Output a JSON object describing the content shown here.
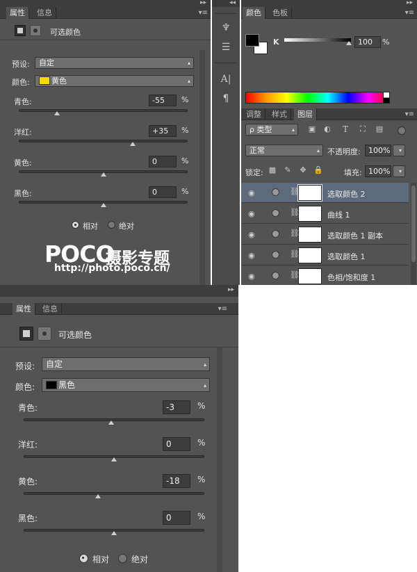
{
  "panel_top": {
    "tabs": [
      "属性",
      "信息"
    ],
    "panel_title": "可选颜色",
    "preset_label": "预设:",
    "preset_value": "自定",
    "color_label": "颜色:",
    "color_value": "黄色",
    "color_swatch": "#f7d900",
    "sliders": [
      {
        "label": "青色:",
        "value": "-55",
        "pos": -55
      },
      {
        "label": "洋红:",
        "value": "+35",
        "pos": 35
      },
      {
        "label": "黄色:",
        "value": "0",
        "pos": 0
      },
      {
        "label": "黑色:",
        "value": "0",
        "pos": 0
      }
    ],
    "pct": "%",
    "radio_relative": "相对",
    "radio_absolute": "绝对"
  },
  "color_panel": {
    "tabs": [
      "颜色",
      "色板"
    ],
    "channel": "K",
    "value": "100",
    "pct": "%"
  },
  "layers_panel": {
    "tabs": [
      "调整",
      "样式",
      "图层"
    ],
    "filter_label": "ρ 类型",
    "blend_mode": "正常",
    "opacity_label": "不透明度:",
    "opacity_value": "100%",
    "lock_label": "锁定:",
    "fill_label": "填充:",
    "fill_value": "100%",
    "layers": [
      {
        "name": "选取颜色 2",
        "selected": true
      },
      {
        "name": "曲线 1",
        "selected": false
      },
      {
        "name": "选取颜色 1 副本",
        "selected": false
      },
      {
        "name": "选取颜色 1",
        "selected": false
      },
      {
        "name": "色相/饱和度 1",
        "selected": false
      }
    ]
  },
  "watermark": {
    "logo": "POCO",
    "text": "摄影专题",
    "url": "http://photo.poco.cn/"
  },
  "panel_bottom": {
    "tabs": [
      "属性",
      "信息"
    ],
    "panel_title": "可选颜色",
    "preset_label": "预设:",
    "preset_value": "自定",
    "color_label": "颜色:",
    "color_value": "黑色",
    "color_swatch": "#000000",
    "sliders": [
      {
        "label": "青色:",
        "value": "-3",
        "pos": -3
      },
      {
        "label": "洋红:",
        "value": "0",
        "pos": 0
      },
      {
        "label": "黄色:",
        "value": "-18",
        "pos": -18
      },
      {
        "label": "黑色:",
        "value": "0",
        "pos": 0
      }
    ],
    "pct": "%",
    "radio_relative": "相对",
    "radio_absolute": "绝对"
  }
}
